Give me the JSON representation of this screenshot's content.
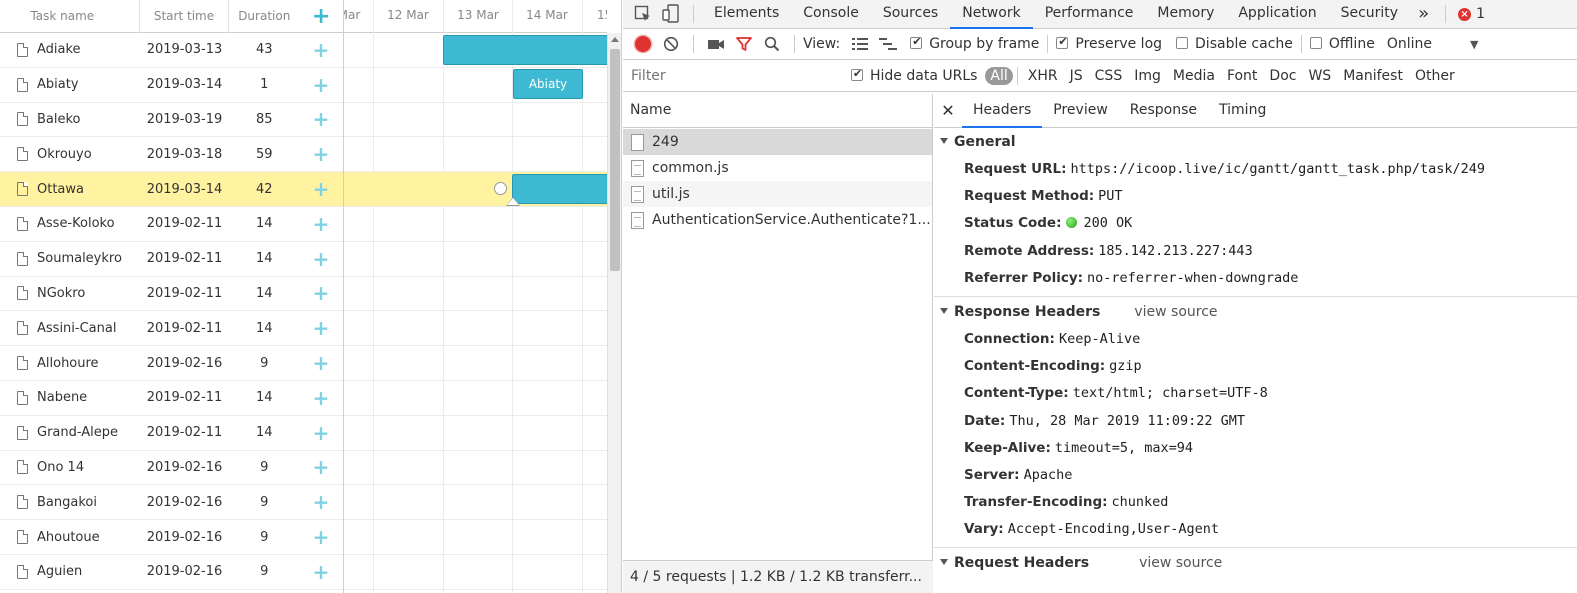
{
  "gantt": {
    "headers": {
      "task_name": "Task name",
      "start_time": "Start time",
      "duration": "Duration",
      "add": "+"
    },
    "tasks": [
      {
        "name": "Adiake",
        "start": "2019-03-13",
        "duration": "43"
      },
      {
        "name": "Abiaty",
        "start": "2019-03-14",
        "duration": "1"
      },
      {
        "name": "Baleko",
        "start": "2019-03-19",
        "duration": "85"
      },
      {
        "name": "Okrouyo",
        "start": "2019-03-18",
        "duration": "59"
      },
      {
        "name": "Ottawa",
        "start": "2019-03-14",
        "duration": "42"
      },
      {
        "name": "Asse-Koloko",
        "start": "2019-02-11",
        "duration": "14"
      },
      {
        "name": "Soumaleykro",
        "start": "2019-02-11",
        "duration": "14"
      },
      {
        "name": "NGokro",
        "start": "2019-02-11",
        "duration": "14"
      },
      {
        "name": "Assini-Canal",
        "start": "2019-02-11",
        "duration": "14"
      },
      {
        "name": "Allohoure",
        "start": "2019-02-16",
        "duration": "9"
      },
      {
        "name": "Nabene",
        "start": "2019-02-11",
        "duration": "14"
      },
      {
        "name": "Grand-Alepe",
        "start": "2019-02-11",
        "duration": "14"
      },
      {
        "name": "Ono 14",
        "start": "2019-02-16",
        "duration": "9"
      },
      {
        "name": "Bangakoi",
        "start": "2019-02-16",
        "duration": "9"
      },
      {
        "name": "Ahoutoue",
        "start": "2019-02-16",
        "duration": "9"
      },
      {
        "name": "Aguien",
        "start": "2019-02-16",
        "duration": "9"
      }
    ],
    "selected_task": "Ottawa",
    "timeline_labels": [
      "Mar",
      "12 Mar",
      "13 Mar",
      "14 Mar",
      "15"
    ],
    "bar_label_abiaty": "Abiaty",
    "colors": {
      "bar": "#3db9d3",
      "selected_row": "#fff3a1",
      "add_icon": "#3db9d3"
    }
  },
  "devtools": {
    "tabs": [
      "Elements",
      "Console",
      "Sources",
      "Network",
      "Performance",
      "Memory",
      "Application",
      "Security"
    ],
    "active_tab": "Network",
    "more_tabs": "»",
    "error_count": "1",
    "toolbar": {
      "view_label": "View:",
      "group_by_frame": "Group by frame",
      "preserve_log": "Preserve log",
      "disable_cache": "Disable cache",
      "offline": "Offline",
      "throttle": "Online"
    },
    "filter": {
      "placeholder": "Filter",
      "hide_data_urls": "Hide data URLs",
      "types": [
        "All",
        "XHR",
        "JS",
        "CSS",
        "Img",
        "Media",
        "Font",
        "Doc",
        "WS",
        "Manifest",
        "Other"
      ]
    },
    "requests": {
      "column": "Name",
      "items": [
        "249",
        "common.js",
        "util.js",
        "AuthenticationService.Authenticate?1..."
      ],
      "footer": "4 / 5 requests  |  1.2 KB / 1.2 KB transferr..."
    },
    "details": {
      "tabs": [
        "Headers",
        "Preview",
        "Response",
        "Timing"
      ],
      "active": "Headers",
      "general": {
        "title": "General",
        "request_url_label": "Request URL:",
        "request_url": "https://icoop.live/ic/gantt/gantt_task.php/task/249",
        "method_label": "Request Method:",
        "method": "PUT",
        "status_label": "Status Code:",
        "status": "200 OK",
        "remote_label": "Remote Address:",
        "remote": "185.142.213.227:443",
        "referrer_label": "Referrer Policy:",
        "referrer": "no-referrer-when-downgrade"
      },
      "response_headers": {
        "title": "Response Headers",
        "view_source": "view source",
        "items": [
          {
            "k": "Connection:",
            "v": "Keep-Alive"
          },
          {
            "k": "Content-Encoding:",
            "v": "gzip"
          },
          {
            "k": "Content-Type:",
            "v": "text/html; charset=UTF-8"
          },
          {
            "k": "Date:",
            "v": "Thu, 28 Mar 2019 11:09:22 GMT"
          },
          {
            "k": "Keep-Alive:",
            "v": "timeout=5, max=94"
          },
          {
            "k": "Server:",
            "v": "Apache"
          },
          {
            "k": "Transfer-Encoding:",
            "v": "chunked"
          },
          {
            "k": "Vary:",
            "v": "Accept-Encoding,User-Agent"
          }
        ]
      },
      "request_headers": {
        "title": "Request Headers",
        "view_source": "view source"
      }
    }
  }
}
